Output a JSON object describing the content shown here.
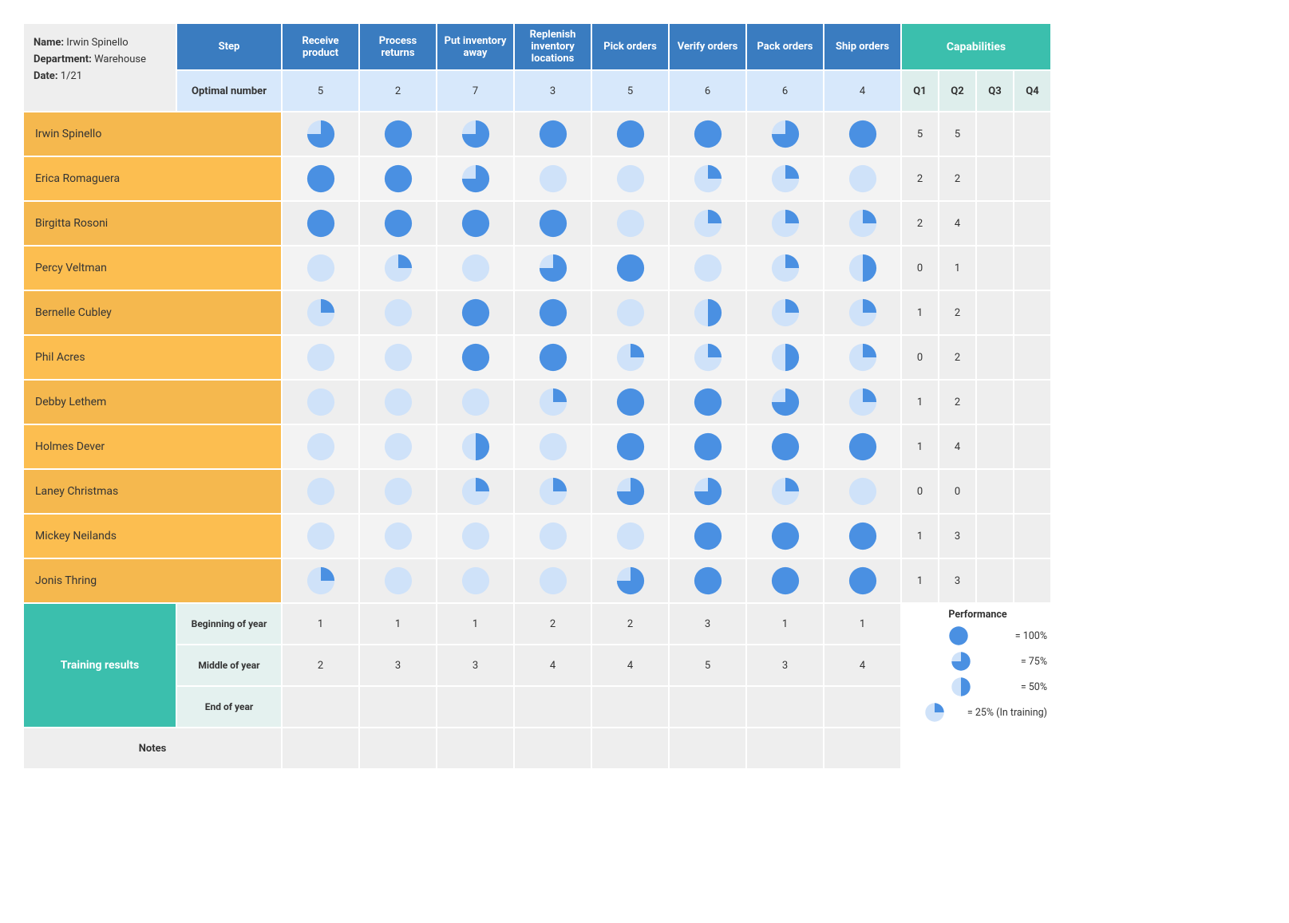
{
  "info": {
    "name_label": "Name:",
    "name_value": "Irwin Spinello",
    "dept_label": "Department:",
    "dept_value": "Warehouse",
    "date_label": "Date:",
    "date_value": "1/21"
  },
  "headers": {
    "step": "Step",
    "optimal": "Optimal number",
    "capabilities": "Capabilities"
  },
  "steps": [
    "Receive product",
    "Process returns",
    "Put inventory away",
    "Replenish inventory locations",
    "Pick orders",
    "Verify orders",
    "Pack orders",
    "Ship orders"
  ],
  "optimal": [
    5,
    2,
    7,
    3,
    5,
    6,
    6,
    4
  ],
  "quarters": [
    "Q1",
    "Q2",
    "Q3",
    "Q4"
  ],
  "employees": [
    {
      "name": "Irwin Spinello",
      "skills": [
        75,
        100,
        75,
        100,
        100,
        100,
        75,
        100
      ],
      "caps": [
        5,
        5,
        "",
        ""
      ]
    },
    {
      "name": "Erica Romaguera",
      "skills": [
        100,
        100,
        75,
        0,
        0,
        25,
        25,
        0
      ],
      "caps": [
        2,
        2,
        "",
        ""
      ]
    },
    {
      "name": "Birgitta Rosoni",
      "skills": [
        100,
        100,
        100,
        100,
        0,
        25,
        25,
        25
      ],
      "caps": [
        2,
        4,
        "",
        ""
      ]
    },
    {
      "name": "Percy Veltman",
      "skills": [
        0,
        25,
        0,
        75,
        100,
        0,
        25,
        50
      ],
      "caps": [
        0,
        1,
        "",
        ""
      ]
    },
    {
      "name": "Bernelle Cubley",
      "skills": [
        25,
        0,
        100,
        100,
        0,
        50,
        25,
        25
      ],
      "caps": [
        1,
        2,
        "",
        ""
      ]
    },
    {
      "name": "Phil Acres",
      "skills": [
        0,
        0,
        100,
        100,
        25,
        25,
        50,
        25
      ],
      "caps": [
        0,
        2,
        "",
        ""
      ]
    },
    {
      "name": "Debby Lethem",
      "skills": [
        0,
        0,
        0,
        25,
        100,
        100,
        75,
        25
      ],
      "caps": [
        1,
        2,
        "",
        ""
      ]
    },
    {
      "name": "Holmes Dever",
      "skills": [
        0,
        0,
        50,
        0,
        100,
        100,
        100,
        100
      ],
      "caps": [
        1,
        4,
        "",
        ""
      ]
    },
    {
      "name": "Laney Christmas",
      "skills": [
        0,
        0,
        25,
        25,
        75,
        75,
        25,
        0
      ],
      "caps": [
        0,
        0,
        "",
        ""
      ]
    },
    {
      "name": "Mickey Neilands",
      "skills": [
        0,
        0,
        0,
        0,
        0,
        100,
        100,
        100
      ],
      "caps": [
        1,
        3,
        "",
        ""
      ]
    },
    {
      "name": "Jonis Thring",
      "skills": [
        25,
        0,
        0,
        0,
        75,
        100,
        100,
        100
      ],
      "caps": [
        1,
        3,
        "",
        ""
      ]
    }
  ],
  "training": {
    "header": "Training results",
    "rows": [
      {
        "label": "Beginning of year",
        "values": [
          1,
          1,
          1,
          2,
          2,
          3,
          1,
          1
        ]
      },
      {
        "label": "Middle of year",
        "values": [
          2,
          3,
          3,
          4,
          4,
          5,
          3,
          4
        ]
      },
      {
        "label": "End of year",
        "values": [
          "",
          "",
          "",
          "",
          "",
          "",
          "",
          ""
        ]
      }
    ]
  },
  "notes_label": "Notes",
  "legend": {
    "title": "Performance",
    "items": [
      {
        "pct": 100,
        "label": "= 100%"
      },
      {
        "pct": 75,
        "label": "= 75%"
      },
      {
        "pct": 50,
        "label": "= 50%"
      },
      {
        "pct": 25,
        "label": "= 25% (In training)"
      }
    ]
  },
  "colors": {
    "fill": "#4a90e2",
    "bg": "#cfe2f9"
  }
}
